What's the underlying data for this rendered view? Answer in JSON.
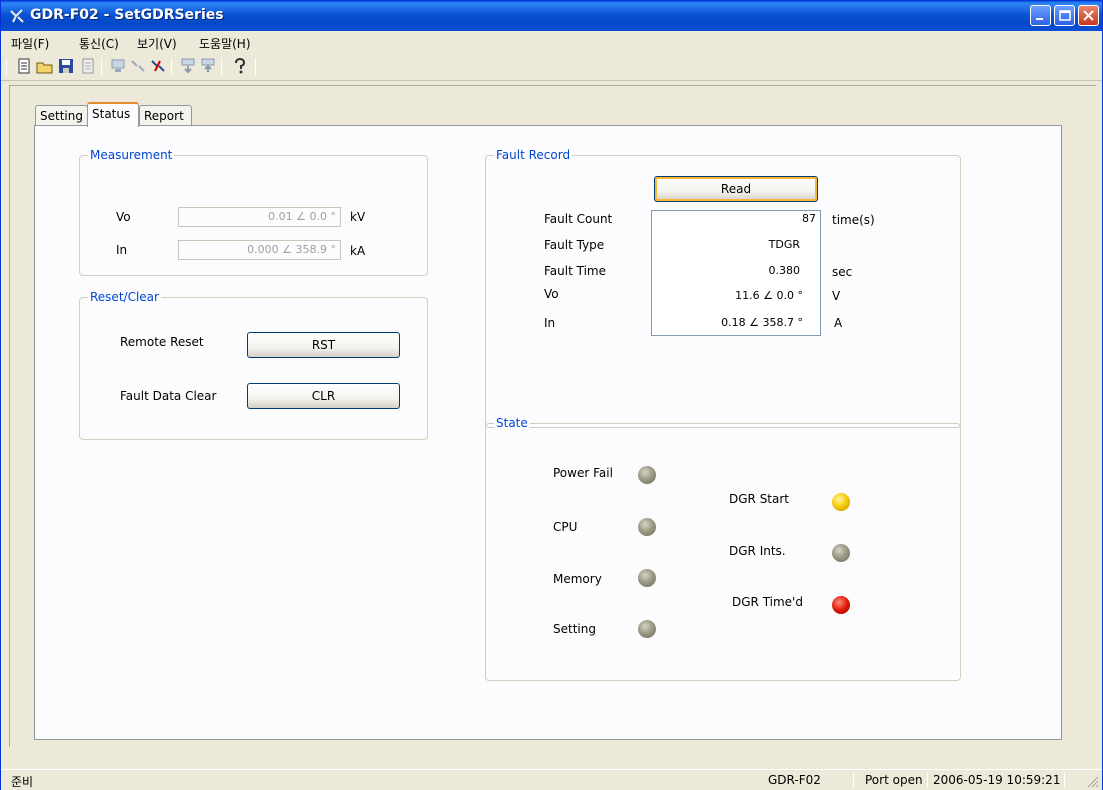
{
  "window": {
    "title": "GDR-F02 - SetGDRSeries"
  },
  "menu": [
    "파일(F)",
    "통신(C)",
    "보기(V)",
    "도움말(H)"
  ],
  "toolbar_icons": [
    "new-icon",
    "open-icon",
    "save-icon",
    "print-icon",
    "connect-icon",
    "disconnect-icon",
    "port-icon",
    "download-icon",
    "upload-icon",
    "help-icon"
  ],
  "tabs": [
    "Setting",
    "Status",
    "Report"
  ],
  "active_tab": "Status",
  "measurement": {
    "title": "Measurement",
    "vo_label": "Vo",
    "vo_value": "0.01 ∠ 0.0 °",
    "vo_unit": "kV",
    "in_label": "In",
    "in_value": "0.000 ∠ 358.9 °",
    "in_unit": "kA"
  },
  "reset_clear": {
    "title": "Reset/Clear",
    "remote_reset_label": "Remote Reset",
    "rst_button": "RST",
    "fault_clear_label": "Fault Data Clear",
    "clr_button": "CLR"
  },
  "fault_record": {
    "title": "Fault Record",
    "read_button": "Read",
    "rows": [
      {
        "label": "Fault Count",
        "value": "87",
        "unit": "time(s)"
      },
      {
        "label": "Fault Type",
        "value": "TDGR",
        "unit": ""
      },
      {
        "label": "Fault Time",
        "value": "0.380",
        "unit": "sec"
      },
      {
        "label": "Vo",
        "value": "11.6 ∠ 0.0 °",
        "unit": "V"
      },
      {
        "label": "In",
        "value": "0.18 ∠ 358.7 °",
        "unit": "A"
      }
    ]
  },
  "state": {
    "title": "State",
    "left": [
      {
        "label": "Power Fail",
        "led": "off"
      },
      {
        "label": "CPU",
        "led": "off"
      },
      {
        "label": "Memory",
        "led": "off"
      },
      {
        "label": "Setting",
        "led": "off"
      }
    ],
    "right": [
      {
        "label": "DGR Start",
        "led": "yellow"
      },
      {
        "label": "DGR Ints.",
        "led": "off"
      },
      {
        "label": "DGR Time'd",
        "led": "red"
      }
    ]
  },
  "statusbar": {
    "left": "준비",
    "device": "GDR-F02",
    "port": "Port open",
    "datetime": "2006-05-19 10:59:21"
  }
}
